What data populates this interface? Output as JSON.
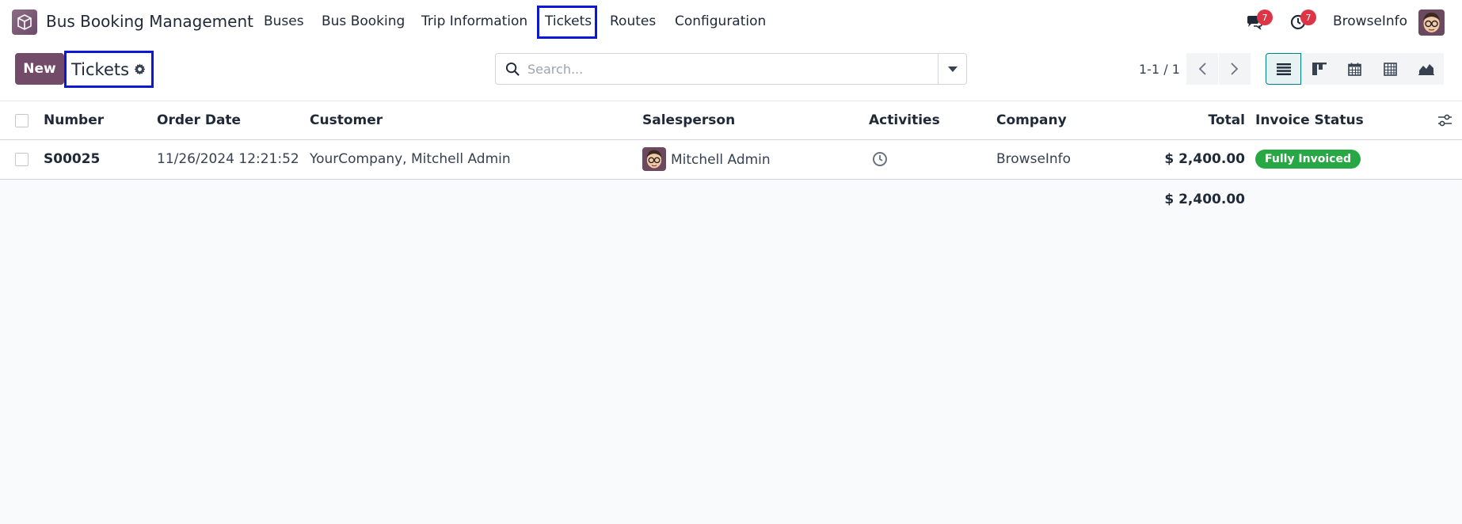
{
  "app": {
    "title": "Bus Booking Management"
  },
  "nav": {
    "items": [
      {
        "label": "Buses"
      },
      {
        "label": "Bus Booking"
      },
      {
        "label": "Trip Information"
      },
      {
        "label": "Tickets"
      },
      {
        "label": "Routes"
      },
      {
        "label": "Configuration"
      }
    ]
  },
  "systray": {
    "messages_count": "7",
    "activities_count": "7",
    "company": "BrowseInfo"
  },
  "control": {
    "new_label": "New",
    "breadcrumb": "Tickets",
    "search_placeholder": "Search...",
    "pager": "1-1 / 1"
  },
  "table": {
    "columns": [
      "Number",
      "Order Date",
      "Customer",
      "Salesperson",
      "Activities",
      "Company",
      "Total",
      "Invoice Status"
    ],
    "rows": [
      {
        "number": "S00025",
        "order_date": "11/26/2024 12:21:52",
        "customer": "YourCompany, Mitchell Admin",
        "salesperson": "Mitchell Admin",
        "company": "BrowseInfo",
        "total": "$ 2,400.00",
        "invoice_status": "Fully Invoiced"
      }
    ],
    "footer_total": "$ 2,400.00"
  },
  "colors": {
    "brand": "#714b67",
    "highlight": "#0d17d6",
    "status_success": "#28a745",
    "badge": "#dc3545"
  }
}
